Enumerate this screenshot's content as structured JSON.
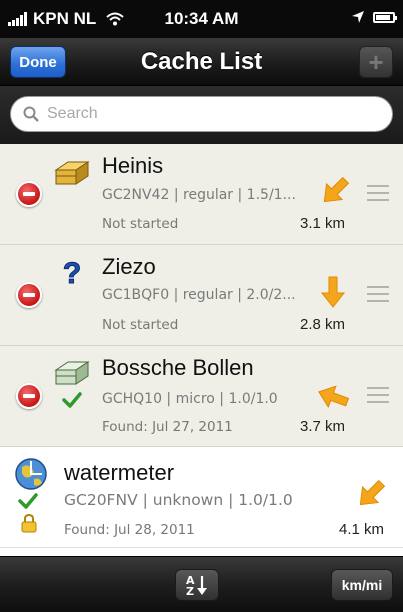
{
  "status_bar": {
    "carrier": "KPN NL",
    "time": "10:34 AM"
  },
  "nav": {
    "done_label": "Done",
    "title": "Cache List",
    "add_label": "+"
  },
  "search": {
    "placeholder": "Search"
  },
  "caches": [
    {
      "name": "Heinis",
      "details": "GC2NV42 | regular | 1.5/1...",
      "status": "Not started",
      "distance": "3.1 km",
      "type_icon": "traditional-cache-icon",
      "arrow_direction": "south-west"
    },
    {
      "name": "Ziezo",
      "details": "GC1BQF0 | regular | 2.0/2...",
      "status": "Not started",
      "distance": "2.8 km",
      "type_icon": "mystery-cache-icon",
      "arrow_direction": "south"
    },
    {
      "name": "Bossche Bollen",
      "details": "GCHQ10 | micro | 1.0/1.0",
      "status": "Found: Jul 27, 2011",
      "distance": "3.7 km",
      "type_icon": "traditional-cache-icon",
      "arrow_direction": "west"
    },
    {
      "name": "watermeter",
      "details": "GC20FNV | unknown | 1.0/1.0",
      "status": "Found: Jul 28, 2011",
      "distance": "4.1 km",
      "type_icon": "earthcache-icon",
      "arrow_direction": "south-west"
    }
  ],
  "toolbar": {
    "sort_icon": "sort-az-icon",
    "units_label": "km/mi"
  },
  "colors": {
    "done_button": "#2b6fd6",
    "delete": "#c81515",
    "arrow": "#f5a51c",
    "found_check": "#2e9a2e",
    "row_bg": "#efefe8"
  }
}
